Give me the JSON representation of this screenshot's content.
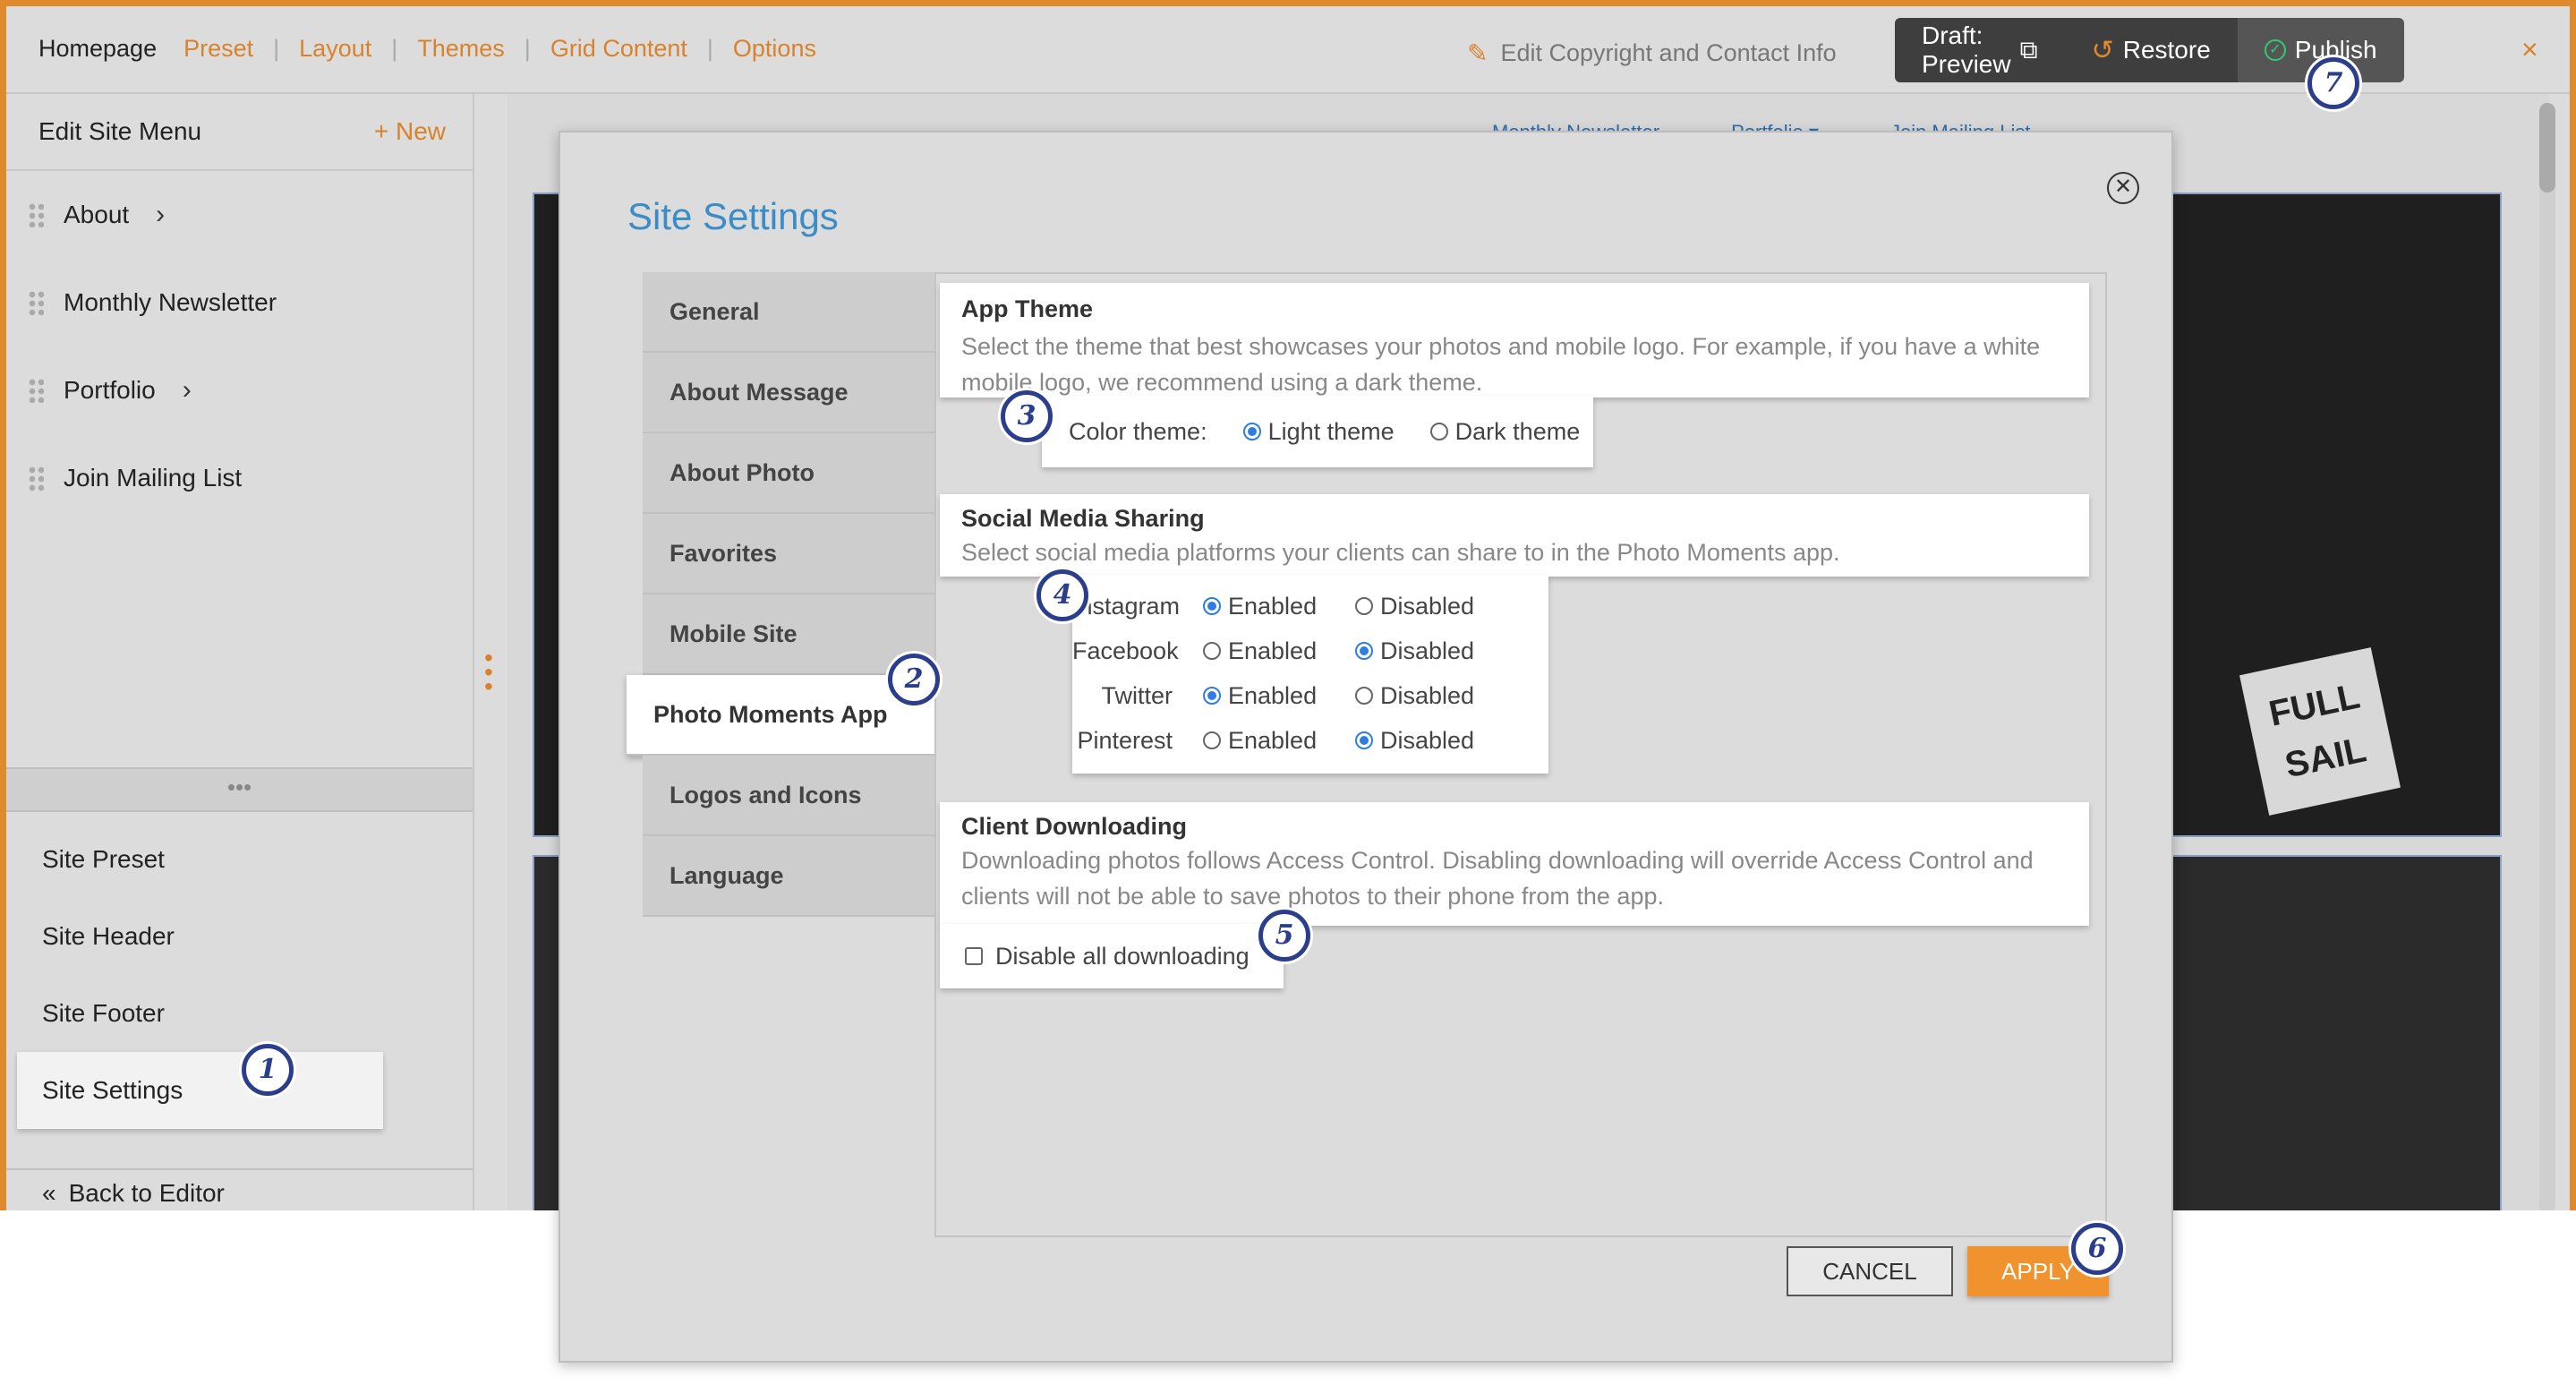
{
  "topbar": {
    "home": "Homepage",
    "links": [
      "Preset",
      "Layout",
      "Themes",
      "Grid Content",
      "Options"
    ],
    "edit_copyright": "Edit Copyright and Contact Info",
    "draft_preview": "Draft: Preview",
    "restore": "Restore",
    "publish": "Publish",
    "close": "×"
  },
  "sidebar": {
    "title": "Edit Site Menu",
    "new_label": "New",
    "items": [
      "About",
      "Monthly Newsletter",
      "Portfolio",
      "Join Mailing List"
    ],
    "bottom_items": [
      "Site Preset",
      "Site Header",
      "Site Footer",
      "Site Settings"
    ],
    "back": "Back to Editor"
  },
  "preview": {
    "nav": [
      "Monthly Newsletter",
      "Portfolio ▾",
      "Join Mailing List"
    ],
    "sign_text": "FULL SAIL"
  },
  "modal": {
    "title": "Site Settings",
    "close": "✕",
    "tabs": [
      "General",
      "About Message",
      "About Photo",
      "Favorites",
      "Mobile Site",
      "Photo Moments App",
      "Logos and Icons",
      "Language"
    ],
    "active_tab": "Photo Moments App",
    "app_theme": {
      "title": "App Theme",
      "desc": "Select the theme that best showcases your photos and mobile logo. For example, if you have a white mobile logo, we recommend using a dark theme.",
      "label": "Color theme:",
      "options": [
        "Light theme",
        "Dark theme"
      ],
      "selected": "Light theme"
    },
    "social": {
      "title": "Social Media Sharing",
      "desc": "Select social media platforms your clients can share to in the Photo Moments app.",
      "enabled_label": "Enabled",
      "disabled_label": "Disabled",
      "platforms": [
        {
          "name": "Instagram",
          "state": "Enabled"
        },
        {
          "name": "Facebook",
          "state": "Disabled"
        },
        {
          "name": "Twitter",
          "state": "Enabled"
        },
        {
          "name": "Pinterest",
          "state": "Disabled"
        }
      ]
    },
    "downloading": {
      "title": "Client Downloading",
      "desc": "Downloading photos follows Access Control. Disabling downloading will override Access Control and clients will not be able to save photos to their phone from the app.",
      "checkbox_label": "Disable all downloading",
      "checked": false
    },
    "cancel": "CANCEL",
    "apply": "APPLY"
  },
  "markers": [
    "1",
    "2",
    "3",
    "4",
    "5",
    "6",
    "7"
  ],
  "colors": {
    "accent": "#e08a2e",
    "title_blue": "#3b8dc7",
    "radio_blue": "#2f7de0",
    "marker_navy": "#2b3e8c"
  }
}
